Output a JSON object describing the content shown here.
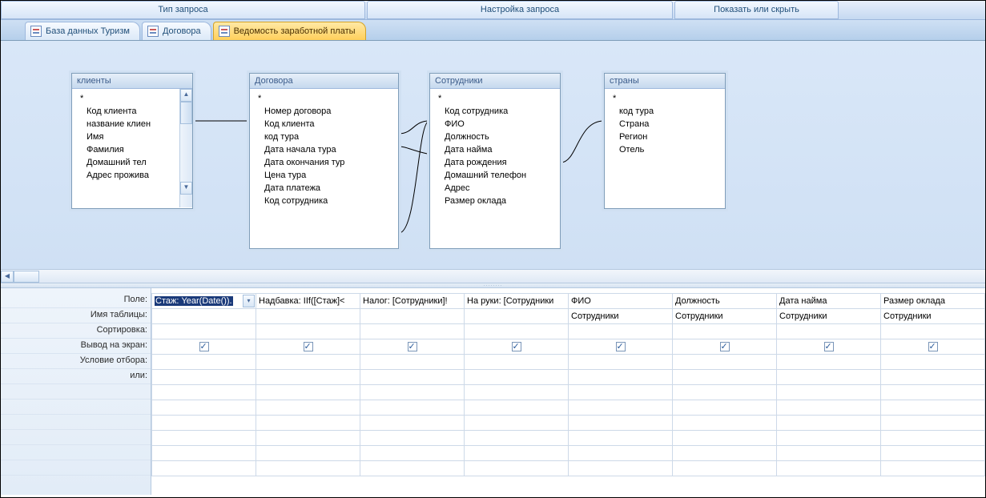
{
  "ribbon": {
    "tabs": [
      "Тип запроса",
      "Настройка запроса",
      "Показать или скрыть"
    ]
  },
  "doc_tabs": [
    {
      "label": "База данных Туризм",
      "active": false
    },
    {
      "label": "Договора",
      "active": false
    },
    {
      "label": "Ведомость заработной платы",
      "active": true
    }
  ],
  "tables": [
    {
      "title": "клиенты",
      "key": "Код клиента",
      "fields": [
        "название клиен",
        "Имя",
        "Фамилия",
        "Домашний тел",
        "Адрес прожива"
      ],
      "scroll": true
    },
    {
      "title": "Договора",
      "key": "Номер договора",
      "fields": [
        "Код клиента",
        "код тура",
        "Дата начала тура",
        "Дата окончания тур",
        "Цена тура",
        "Дата платежа",
        "Код сотрудника"
      ]
    },
    {
      "title": "Сотрудники",
      "key": "Код сотрудника",
      "fields": [
        "ФИО",
        "Должность",
        "Дата найма",
        "Дата рождения",
        "Домашний телефон",
        "Адрес",
        "Размер оклада"
      ]
    },
    {
      "title": "страны",
      "key": "код тура",
      "fields": [
        "Страна",
        "Регион",
        "Отель"
      ]
    }
  ],
  "grid_labels": [
    "Поле:",
    "Имя таблицы:",
    "Сортировка:",
    "Вывод на экран:",
    "Условие отбора:",
    "или:"
  ],
  "grid_columns": [
    {
      "field_hl": "Стаж: Year(Date()).",
      "table": "",
      "show": true,
      "active": true
    },
    {
      "field": "Надбавка: IIf([Стаж]<",
      "table": "",
      "show": true
    },
    {
      "field": "Налог: [Сотрудники]!",
      "table": "",
      "show": true
    },
    {
      "field": "На руки: [Сотрудники",
      "table": "",
      "show": true
    },
    {
      "field": "ФИО",
      "table": "Сотрудники",
      "show": true
    },
    {
      "field": "Должность",
      "table": "Сотрудники",
      "show": true
    },
    {
      "field": "Дата найма",
      "table": "Сотрудники",
      "show": true
    },
    {
      "field": "Размер оклада",
      "table": "Сотрудники",
      "show": true
    }
  ]
}
